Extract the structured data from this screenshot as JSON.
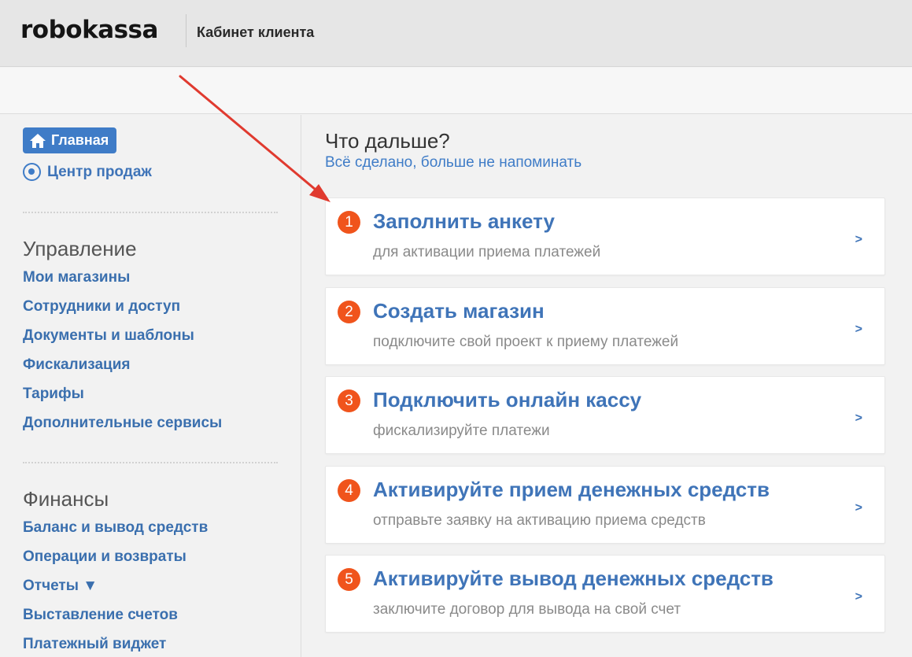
{
  "header": {
    "logo": "robokassa",
    "cabinet_title": "Кабинет клиента"
  },
  "sidebar": {
    "home_label": "Главная",
    "sales_center_label": "Центр продаж",
    "management": {
      "heading": "Управление",
      "items": [
        "Мои магазины",
        "Сотрудники и доступ",
        "Документы и шаблоны",
        "Фискализация",
        "Тарифы",
        "Дополнительные сервисы"
      ]
    },
    "finance": {
      "heading": "Финансы",
      "items": [
        "Баланс и вывод средств",
        "Операции и возвраты",
        "Отчеты ▼",
        "Выставление счетов",
        "Платежный виджет"
      ]
    }
  },
  "main": {
    "title": "Что дальше?",
    "dismiss_link": "Всё сделано, больше не напоминать",
    "steps": [
      {
        "number": "1",
        "title": "Заполнить анкету",
        "subtitle": "для активации приема платежей",
        "chevron": ">"
      },
      {
        "number": "2",
        "title": "Создать магазин",
        "subtitle": "подключите свой проект к приему платежей",
        "chevron": ">"
      },
      {
        "number": "3",
        "title": "Подключить онлайн кассу",
        "subtitle": "фискализируйте платежи",
        "chevron": ">"
      },
      {
        "number": "4",
        "title": "Активируйте прием денежных средств",
        "subtitle": "отправьте заявку на активацию приема средств",
        "chevron": ">"
      },
      {
        "number": "5",
        "title": "Активируйте вывод денежных средств",
        "subtitle": "заключите договор для вывода на свой счет",
        "chevron": ">"
      }
    ]
  },
  "colors": {
    "accent_blue": "#3f7cc7",
    "step_badge": "#f0541c",
    "annotation_arrow": "#e03a2f"
  },
  "icons": {
    "home": "home-icon",
    "sales_center": "target-icon",
    "annotation": "arrow-pointer-icon"
  }
}
